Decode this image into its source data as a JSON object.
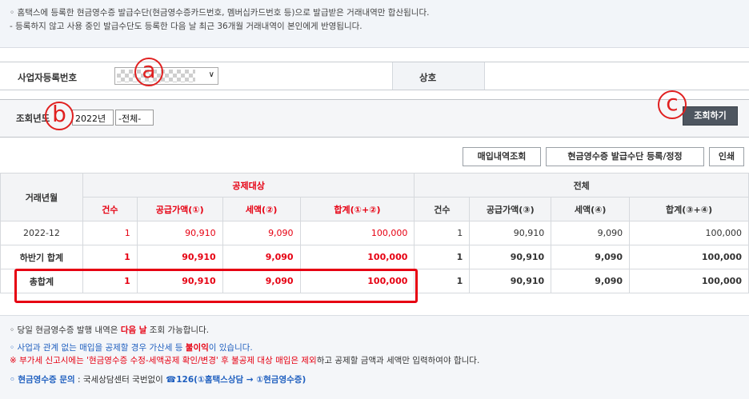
{
  "notice_top": {
    "line1": "◦ 홈택스에 등록한 현금영수증 발급수단(현금영수증카드번호, 멤버십카드번호 등)으로 발급받은 거래내역만 합산됩니다.",
    "line2": "- 등록하지 않고 사용 중인 발급수단도 등록한 다음 날 최근 36개월 거래내역이 본인에게 반영됩니다."
  },
  "biz": {
    "label": "사업자등록번호",
    "select_arrow": "∨",
    "sangho_label": "상호"
  },
  "query": {
    "label": "조회년도",
    "year": "2022년",
    "period": "-전체-",
    "search_btn": "조회하기"
  },
  "annotations": {
    "a": "a",
    "b": "b",
    "c": "c"
  },
  "actions": {
    "purchase": "매입내역조회",
    "register": "현금영수증 발급수단 등록/정정",
    "print": "인쇄"
  },
  "table": {
    "col_date": "거래년월",
    "group_deduct": "공제대상",
    "group_total": "전체",
    "h_count": "건수",
    "h_supply1": "공급가액(①)",
    "h_tax2": "세액(②)",
    "h_sum12": "합계(①+②)",
    "h_count2": "건수",
    "h_supply3": "공급가액(③)",
    "h_tax4": "세액(④)",
    "h_sum34": "합계(③+④)",
    "rows": [
      {
        "label": "2022-12",
        "c1": "1",
        "s1": "90,910",
        "t1": "9,090",
        "sum1": "100,000",
        "c2": "1",
        "s2": "90,910",
        "t2": "9,090",
        "sum2": "100,000"
      },
      {
        "label": "하반기 합계",
        "c1": "1",
        "s1": "90,910",
        "t1": "9,090",
        "sum1": "100,000",
        "c2": "1",
        "s2": "90,910",
        "t2": "9,090",
        "sum2": "100,000"
      },
      {
        "label": "총합계",
        "c1": "1",
        "s1": "90,910",
        "t1": "9,090",
        "sum1": "100,000",
        "c2": "1",
        "s2": "90,910",
        "t2": "9,090",
        "sum2": "100,000"
      }
    ]
  },
  "notes": {
    "n1a": "◦ 당일 현금영수증 발행 내역은 ",
    "n1b": "다음 날",
    "n1c": " 조회 가능합니다.",
    "n2a": "◦ 사업과 관계 없는 매입을 공제할 경우 가산세 등 ",
    "n2b": "불이익",
    "n2c": "이 있습니다.",
    "n3a": "※ 부가세 신고시에는 '현금영수증 수정-세액공제 확인/변경' 후 불공제 대상 매입은 제외",
    "n3b": "하고 공제할 금액과 세액만 입력하여야 합니다.",
    "n4a": "◦ 현금영수증 문의",
    "n4b": " : 국세상담센터 국번없이 ",
    "n4c": "☎126(①홈택스상담 → ①현금영수증)"
  }
}
